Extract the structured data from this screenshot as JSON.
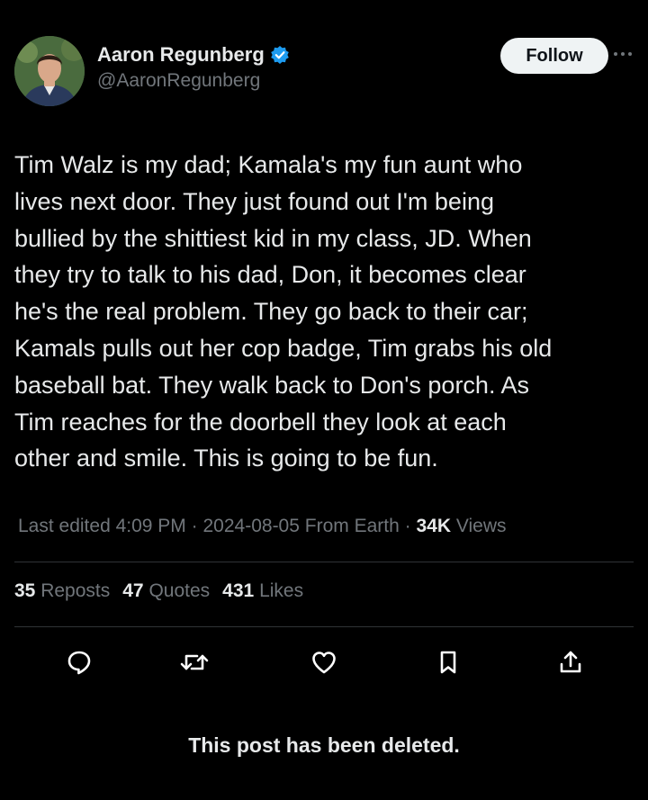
{
  "author": {
    "display_name": "Aaron Regunberg",
    "handle": "@AaronRegunberg",
    "verified": true
  },
  "header": {
    "follow_label": "Follow",
    "more_icon": "more-horizontal-icon"
  },
  "tweet": {
    "text": "Tim Walz is my dad; Kamala's my fun aunt who\nlives next door. They just found out I'm being\nbullied by the shittiest kid in my class, JD. When\nthey try to talk to his dad, Don, it becomes clear\nhe's the real problem. They go back to their car;\nKamals pulls out her cop badge, Tim grabs his old\nbaseball bat. They walk back to Don's porch. As\nTim reaches for the doorbell they look at each\nother and smile. This is going to be fun."
  },
  "meta": {
    "edited_label": "Last edited",
    "time": "4:09 PM",
    "separator": "·",
    "date": "2024-08-05",
    "source": "From Earth",
    "views_count": "34K",
    "views_label": "Views"
  },
  "stats": {
    "reposts_count": "35",
    "reposts_label": "Reposts",
    "quotes_count": "47",
    "quotes_label": "Quotes",
    "likes_count": "431",
    "likes_label": "Likes"
  },
  "actions": [
    "reply-icon",
    "repost-icon",
    "like-icon",
    "bookmark-icon",
    "share-icon"
  ],
  "footer": {
    "deleted_notice": "This post has been deleted."
  },
  "colors": {
    "background": "#000000",
    "text": "#e7e9ea",
    "secondary_text": "#71767b",
    "verified_blue": "#1d9bf0",
    "divider": "#2f3336",
    "follow_button_bg": "#eff3f4"
  }
}
